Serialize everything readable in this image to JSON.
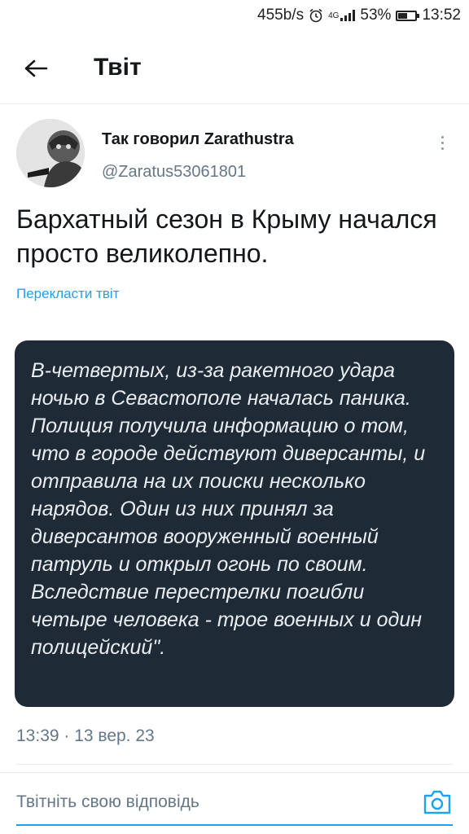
{
  "status_bar": {
    "network_speed": "455b/s",
    "network_type": "4G",
    "battery_percent": "53%",
    "battery_level": 0.53,
    "time": "13:52",
    "alarm_icon": "alarm-clock-icon",
    "signal_icon": "signal-bars-icon",
    "battery_icon": "battery-icon"
  },
  "header": {
    "back_icon": "arrow-left-icon",
    "title": "Твіт"
  },
  "tweet": {
    "author_name": "Так говорил Zarathustra",
    "author_handle": "@Zaratus53061801",
    "text": "Бархатный сезон в Крыму начался просто великолепно.",
    "translate_label": "Перекласти твіт",
    "media_text": "В-четвертых, из-за ракетного удара ночью в Севастополе началась паника. Полиция получила информацию о том, что в городе действуют диверсанты, и отправила на их поиски несколько нарядов. Один из них принял за диверсантов вооруженный военный патруль и открыл огонь по своим. Вследствие перестрелки погибли четыре человека - трое военных и один полицейский\".",
    "timestamp": "13:39 · 13 вер. 23",
    "more_icon": "more-vertical-icon"
  },
  "reply": {
    "placeholder": "Твітніть свою відповідь",
    "camera_icon": "camera-icon"
  },
  "colors": {
    "accent": "#1da1f2",
    "media_bg": "#1e2a35",
    "secondary_text": "#657786"
  }
}
